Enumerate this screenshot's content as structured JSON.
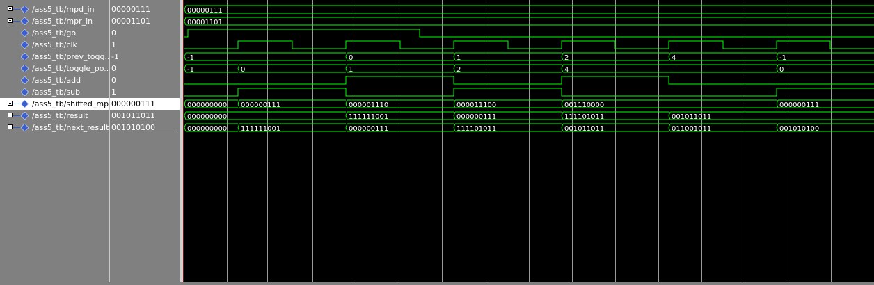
{
  "signals": [
    {
      "name": "/ass5_tb/mpd_in",
      "value": "00000111",
      "expandable": true,
      "selected": false
    },
    {
      "name": "/ass5_tb/mpr_in",
      "value": "00001101",
      "expandable": true,
      "selected": false
    },
    {
      "name": "/ass5_tb/go",
      "value": "0",
      "expandable": false,
      "selected": false
    },
    {
      "name": "/ass5_tb/clk",
      "value": "1",
      "expandable": false,
      "selected": false
    },
    {
      "name": "/ass5_tb/prev_togg...",
      "value": "-1",
      "expandable": false,
      "selected": false
    },
    {
      "name": "/ass5_tb/toggle_po...",
      "value": "0",
      "expandable": false,
      "selected": false
    },
    {
      "name": "/ass5_tb/add",
      "value": "0",
      "expandable": false,
      "selected": false
    },
    {
      "name": "/ass5_tb/sub",
      "value": "1",
      "expandable": false,
      "selected": false
    },
    {
      "name": "/ass5_tb/shifted_mpd",
      "value": "000000111",
      "expandable": true,
      "selected": true
    },
    {
      "name": "/ass5_tb/result",
      "value": "001011011",
      "expandable": true,
      "selected": false
    },
    {
      "name": "/ass5_tb/next_result",
      "value": "001010100",
      "expandable": true,
      "selected": false
    }
  ],
  "colors": {
    "wave": "#00ff00",
    "grid": "#ffffff",
    "panel_bg": "#808080",
    "wave_bg": "#000000",
    "icon": "#3a5fcd"
  },
  "icons": {
    "expand": "plus-box-icon",
    "signal": "diamond-signal-icon"
  },
  "waves": [
    {
      "type": "bus",
      "segments": [
        {
          "t": 0,
          "label": "00000111"
        }
      ]
    },
    {
      "type": "bus",
      "segments": [
        {
          "t": 0,
          "label": "00001101"
        }
      ]
    },
    {
      "type": "bit",
      "init": 0,
      "edges": [
        [
          0,
          0
        ],
        [
          5,
          1
        ],
        [
          338,
          0
        ]
      ]
    },
    {
      "type": "bit",
      "init": 0,
      "edges": [
        [
          0,
          0
        ],
        [
          77,
          1
        ],
        [
          155,
          0
        ],
        [
          232,
          1
        ],
        [
          310,
          0
        ],
        [
          387,
          1
        ],
        [
          465,
          0
        ],
        [
          542,
          1
        ],
        [
          619,
          0
        ],
        [
          696,
          1
        ],
        [
          774,
          0
        ],
        [
          851,
          1
        ],
        [
          928,
          0
        ]
      ]
    },
    {
      "type": "bus",
      "segments": [
        {
          "t": 0,
          "label": "-1"
        },
        {
          "t": 232,
          "label": "0"
        },
        {
          "t": 387,
          "label": "1"
        },
        {
          "t": 542,
          "label": "2"
        },
        {
          "t": 696,
          "label": "4"
        },
        {
          "t": 851,
          "label": "-1"
        }
      ]
    },
    {
      "type": "bus",
      "segments": [
        {
          "t": 0,
          "label": "-1"
        },
        {
          "t": 77,
          "label": "0"
        },
        {
          "t": 232,
          "label": "1"
        },
        {
          "t": 387,
          "label": "2"
        },
        {
          "t": 542,
          "label": "4"
        },
        {
          "t": 851,
          "label": "0"
        }
      ]
    },
    {
      "type": "bit",
      "init": 0,
      "edges": [
        [
          0,
          0
        ],
        [
          232,
          1
        ],
        [
          387,
          0
        ],
        [
          542,
          1
        ],
        [
          696,
          0
        ]
      ]
    },
    {
      "type": "bit",
      "init": 0,
      "edges": [
        [
          0,
          0
        ],
        [
          77,
          1
        ],
        [
          232,
          0
        ],
        [
          387,
          1
        ],
        [
          542,
          0
        ],
        [
          851,
          1
        ]
      ]
    },
    {
      "type": "bus",
      "segments": [
        {
          "t": 0,
          "label": "000000000"
        },
        {
          "t": 77,
          "label": "000000111"
        },
        {
          "t": 232,
          "label": "000001110"
        },
        {
          "t": 387,
          "label": "000011100"
        },
        {
          "t": 542,
          "label": "001110000"
        },
        {
          "t": 851,
          "label": "000000111"
        }
      ]
    },
    {
      "type": "bus",
      "segments": [
        {
          "t": 0,
          "label": "000000000"
        },
        {
          "t": 232,
          "label": "111111001"
        },
        {
          "t": 387,
          "label": "000000111"
        },
        {
          "t": 542,
          "label": "111101011"
        },
        {
          "t": 696,
          "label": "001011011"
        }
      ]
    },
    {
      "type": "bus",
      "segments": [
        {
          "t": 0,
          "label": "000000000"
        },
        {
          "t": 77,
          "label": "111111001"
        },
        {
          "t": 232,
          "label": "000000111"
        },
        {
          "t": 387,
          "label": "111101011"
        },
        {
          "t": 542,
          "label": "001011011"
        },
        {
          "t": 696,
          "label": "011001011"
        },
        {
          "t": 851,
          "label": "001010100"
        }
      ]
    }
  ],
  "gridlines": [
    63,
    121,
    186,
    248,
    310,
    372,
    435,
    497,
    559,
    621,
    683,
    745,
    807,
    869,
    931
  ]
}
